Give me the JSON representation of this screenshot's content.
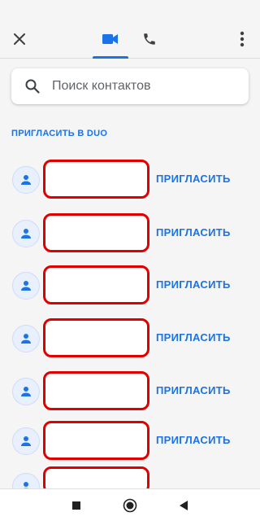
{
  "search": {
    "placeholder": "Поиск контактов"
  },
  "section": {
    "title": "ПРИГЛАСИТЬ В DUO"
  },
  "contacts": [
    {
      "action": "ПРИГЛАСИТЬ"
    },
    {
      "action": "ПРИГЛАСИТЬ"
    },
    {
      "action": "ПРИГЛАСИТЬ"
    },
    {
      "action": "ПРИГЛАСИТЬ"
    },
    {
      "action": "ПРИГЛАСИТЬ"
    },
    {
      "action": "ПРИГЛАСИТЬ"
    },
    {
      "action": ""
    }
  ],
  "icons": {
    "close": "close-icon",
    "video_tab": "videocam-icon",
    "phone_tab": "phone-icon",
    "menu": "more-vert-icon",
    "search": "search-icon",
    "avatar": "person-icon",
    "nav_recents": "square-icon",
    "nav_home": "circle-icon",
    "nav_back": "triangle-back-icon"
  },
  "colors": {
    "accent": "#1a73e8",
    "redaction": "#e00000",
    "background": "#f5f5f5"
  }
}
